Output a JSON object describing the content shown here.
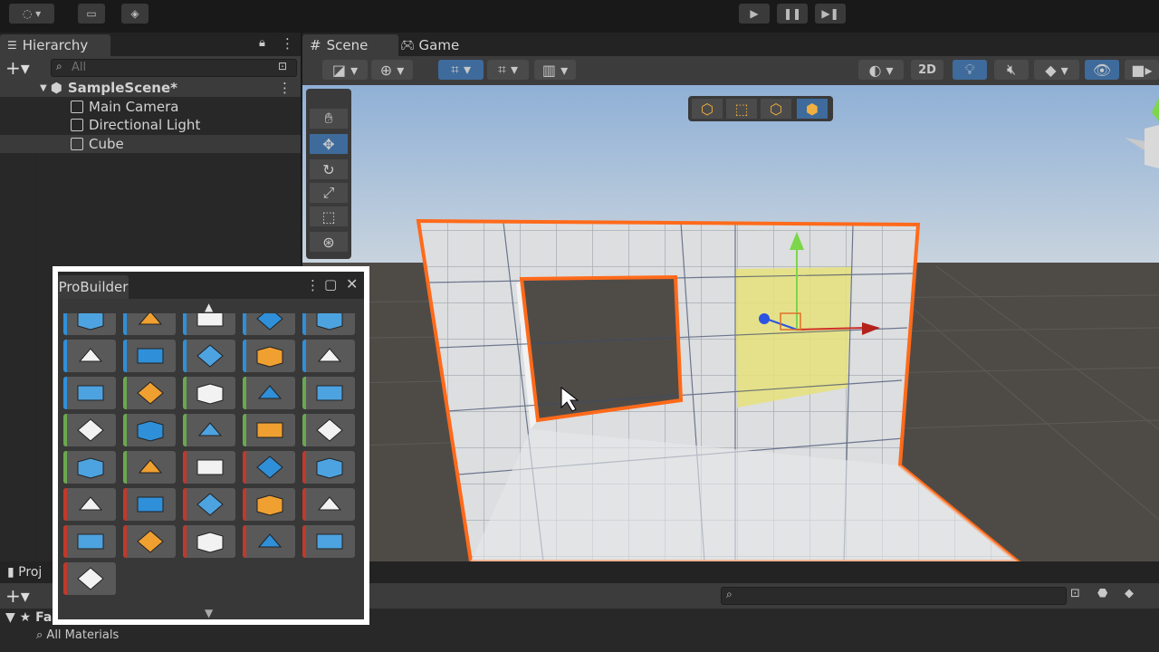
{
  "toolbar": {
    "play_icon": "play-icon",
    "pause_icon": "pause-icon",
    "step_icon": "step-icon"
  },
  "hierarchy": {
    "tab_label": "Hierarchy",
    "search_placeholder": "All",
    "scene_name": "SampleScene*",
    "items": [
      {
        "label": "Main Camera"
      },
      {
        "label": "Directional Light"
      },
      {
        "label": "Cube"
      }
    ]
  },
  "scene_view": {
    "tabs": [
      {
        "label": "Scene"
      },
      {
        "label": "Game"
      }
    ],
    "toggle_2d": "2D"
  },
  "probuilder": {
    "title": "ProBuilder",
    "accent_colors": {
      "blue": "#2f8fd8",
      "green": "#6aa84f",
      "red": "#c0392b",
      "orange": "#e8a317"
    }
  },
  "bottom_panel": {
    "project_tab": "Proj",
    "favorites": "Fa",
    "all_materials": "All Materials"
  },
  "colors": {
    "selection_outline": "#ff6a1a",
    "selected_face": "#e8e37a",
    "gizmo_y": "#7cd64a",
    "gizmo_x": "#d0302a",
    "gizmo_z": "#2b55e0"
  }
}
